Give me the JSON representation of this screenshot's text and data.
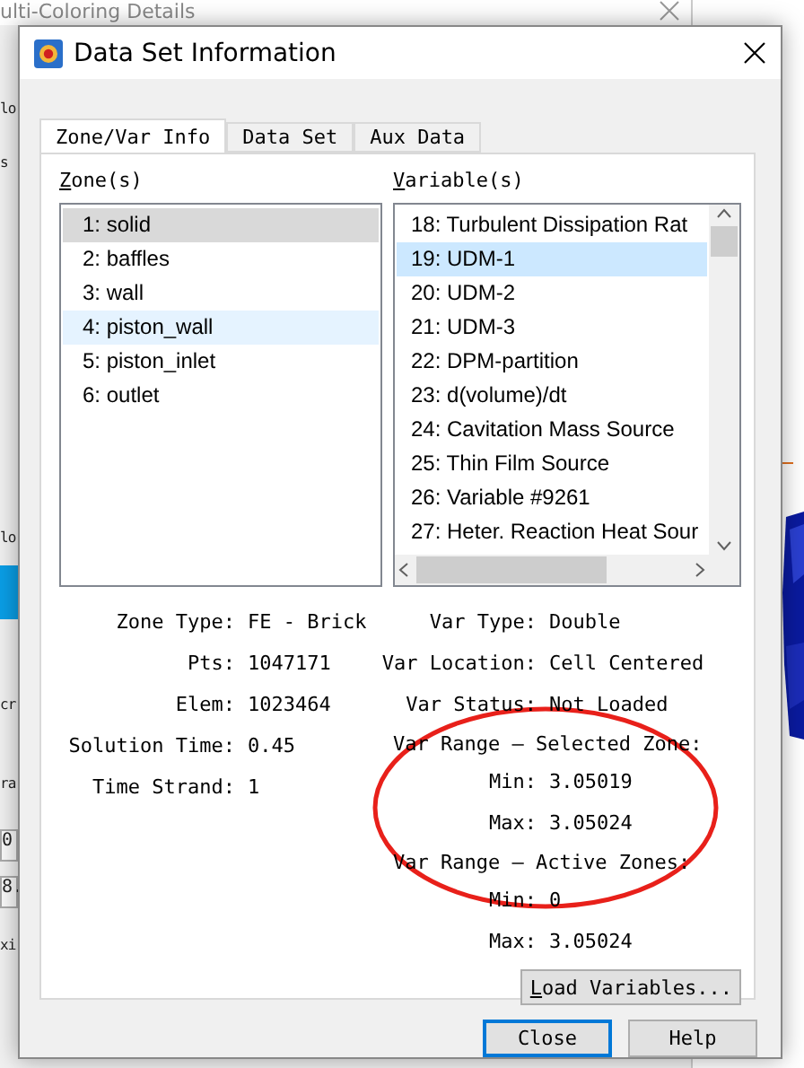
{
  "background_window": {
    "title": "ulti-Coloring Details",
    "fragments": [
      {
        "text": "lo",
        "kind": "text"
      },
      {
        "text": "s",
        "kind": "text"
      },
      {
        "text": "lo",
        "kind": "text"
      },
      {
        "kind": "highlight"
      },
      {
        "text": "cr",
        "kind": "text"
      },
      {
        "text": "ra",
        "kind": "text"
      },
      {
        "text": "0",
        "kind": "field"
      },
      {
        "text": "8.",
        "kind": "field"
      },
      {
        "text": "xi",
        "kind": "text"
      }
    ]
  },
  "dialog": {
    "title": "Data Set Information",
    "tabs": [
      {
        "label": "Zone/Var Info",
        "selected": true
      },
      {
        "label": "Data Set",
        "selected": false
      },
      {
        "label": "Aux Data",
        "selected": false
      }
    ],
    "zones": {
      "label": "Zone(s)",
      "items": [
        {
          "label": "1: solid",
          "selected": true,
          "hover": false
        },
        {
          "label": "2: baffles",
          "selected": false,
          "hover": false
        },
        {
          "label": "3: wall",
          "selected": false,
          "hover": false
        },
        {
          "label": "4: piston_wall",
          "selected": false,
          "hover": true
        },
        {
          "label": "5: piston_inlet",
          "selected": false,
          "hover": false
        },
        {
          "label": "6: outlet",
          "selected": false,
          "hover": false
        }
      ]
    },
    "variables": {
      "label": "Variable(s)",
      "items": [
        {
          "label": "18: Turbulent Dissipation Rat",
          "selected": false
        },
        {
          "label": "19: UDM-1",
          "selected": true
        },
        {
          "label": "20: UDM-2",
          "selected": false
        },
        {
          "label": "21: UDM-3",
          "selected": false
        },
        {
          "label": "22: DPM-partition",
          "selected": false
        },
        {
          "label": "23: d(volume)/dt",
          "selected": false
        },
        {
          "label": "24: Cavitation Mass Source",
          "selected": false
        },
        {
          "label": "25: Thin Film Source",
          "selected": false
        },
        {
          "label": "26: Variable #9261",
          "selected": false
        },
        {
          "label": "27: Heter. Reaction Heat Sour",
          "selected": false
        }
      ]
    },
    "zone_info": [
      {
        "label": "Zone Type:",
        "value": "FE - Brick"
      },
      {
        "label": "Pts:",
        "value": "1047171"
      },
      {
        "label": "Elem:",
        "value": "1023464"
      },
      {
        "label": "Solution Time:",
        "value": "0.45"
      },
      {
        "label": "Time Strand:",
        "value": "1"
      }
    ],
    "var_info": [
      {
        "kind": "pair",
        "label": "Var Type:",
        "value": "Double"
      },
      {
        "kind": "pair",
        "label": "Var Location:",
        "value": "Cell Centered"
      },
      {
        "kind": "pair",
        "label": "Var Status:",
        "value": "Not Loaded"
      },
      {
        "kind": "heading",
        "label": "Var Range — Selected Zone:"
      },
      {
        "kind": "range",
        "label": "Min:",
        "value": "3.05019"
      },
      {
        "kind": "range",
        "label": "Max:",
        "value": "3.05024"
      },
      {
        "kind": "heading",
        "label": "Var Range — Active Zones:"
      },
      {
        "kind": "range",
        "label": "Min:",
        "value": "0"
      },
      {
        "kind": "range",
        "label": "Max:",
        "value": "3.05024"
      }
    ],
    "load_button": "Load Variables...",
    "buttons": [
      {
        "label": "Close",
        "default": true
      },
      {
        "label": "Help",
        "default": false
      }
    ]
  }
}
